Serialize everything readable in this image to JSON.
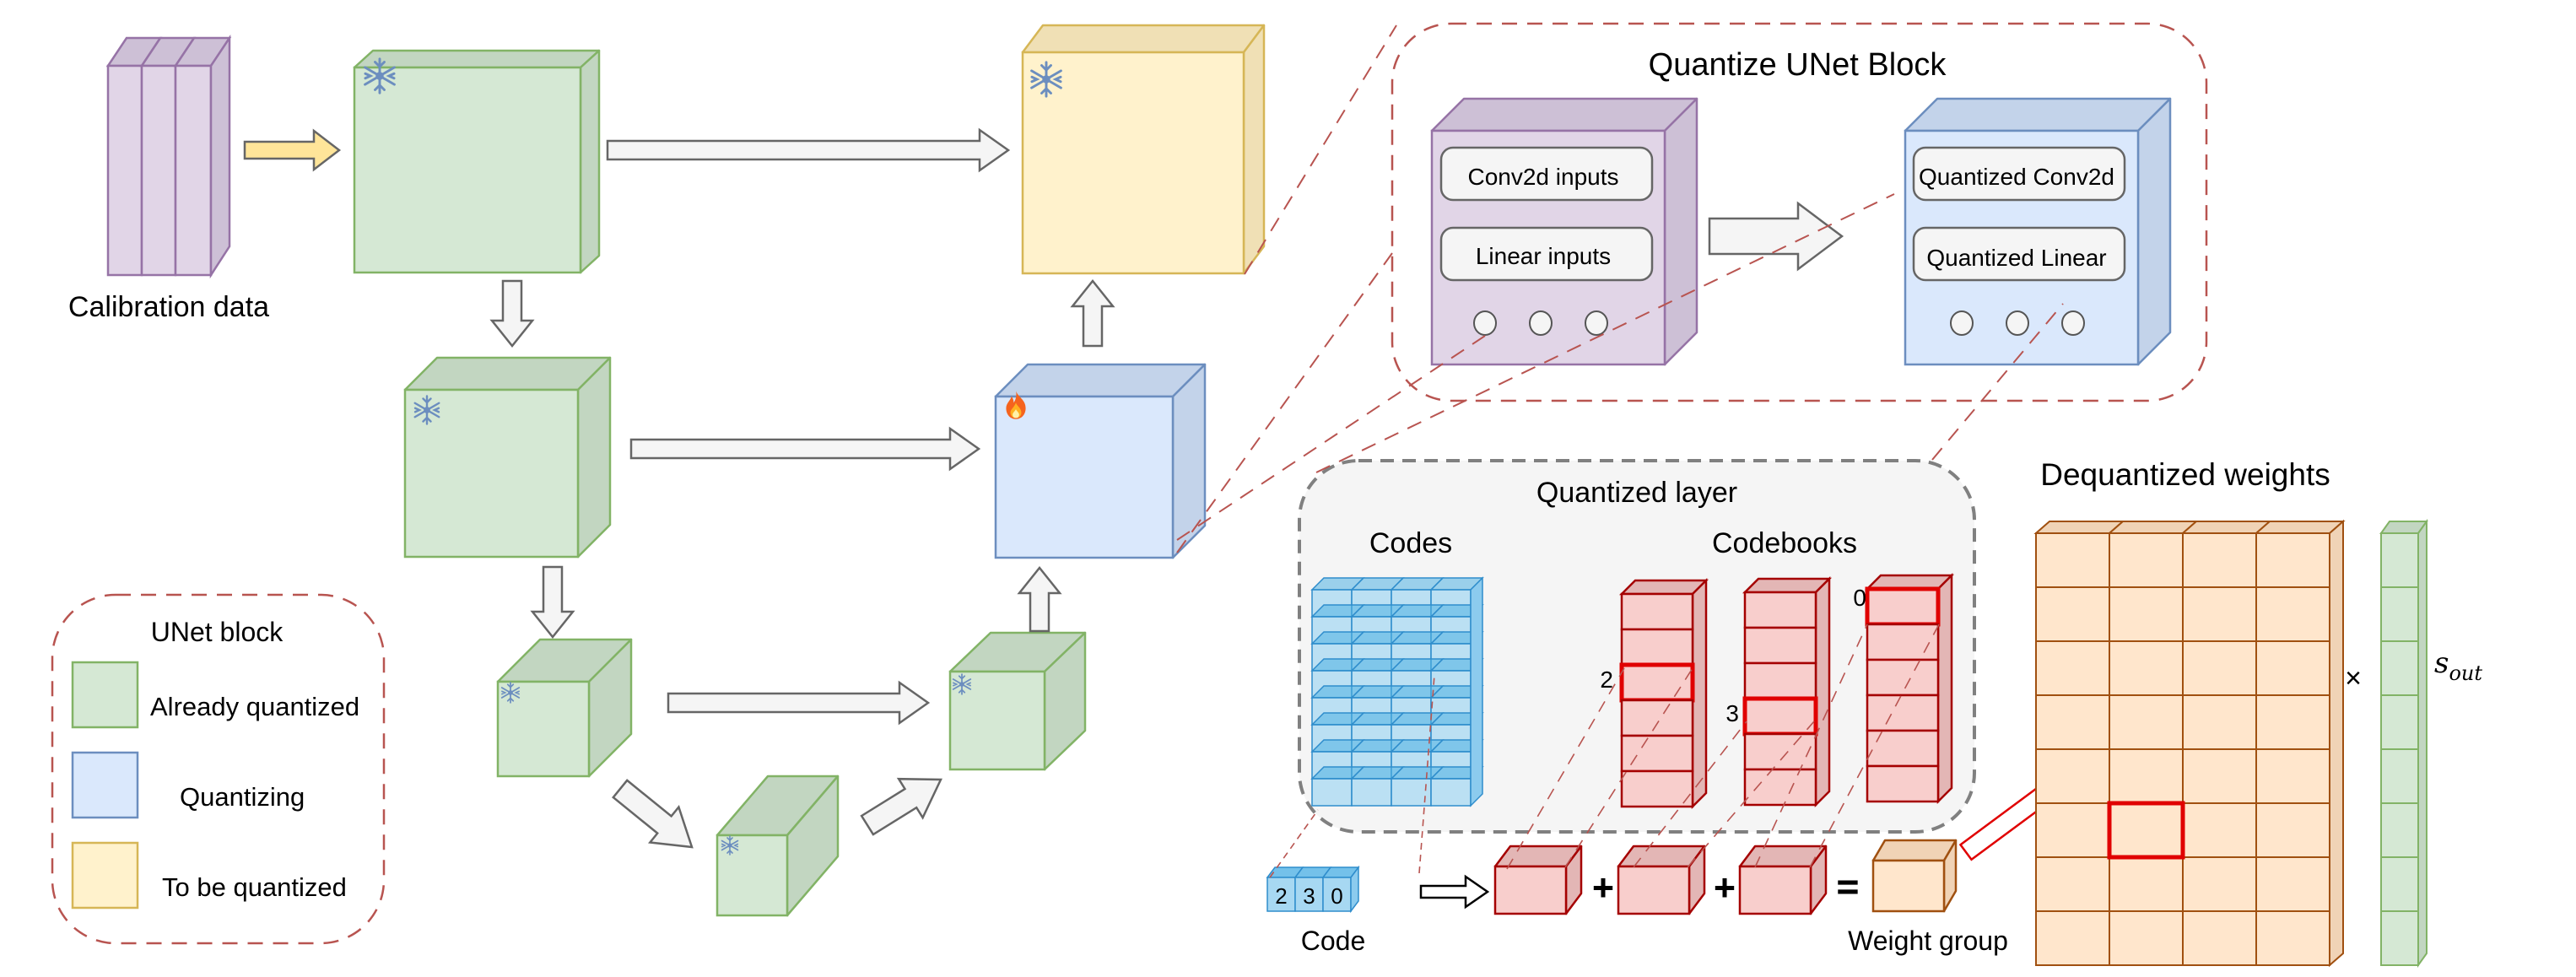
{
  "colors": {
    "green_fill": "#d5e8d4",
    "green_side": "#c2d6c1",
    "green_stroke": "#82b366",
    "blue_fill": "#dae8fc",
    "blue_side": "#c3d3ea",
    "blue_stroke": "#6c8ebf",
    "yellow_fill": "#fff2cc",
    "yellow_side": "#f0e0b5",
    "yellow_stroke": "#d6b656",
    "purple_fill": "#e1d5e7",
    "purple_side": "#cdc0d6",
    "purple_stroke": "#9673a6",
    "red_fill": "#f8cecc",
    "red_side": "#e3b6b5",
    "red_stroke": "#a50000",
    "highlight_red": "#e00000",
    "orange_fill": "#ffe6cc",
    "orange_side": "#f0d3b6",
    "orange_stroke": "#a05010",
    "code_fill": "#a7d8f2",
    "code_stroke": "#2f8dcc",
    "dashed_red": "#b85450",
    "arrow_fill": "#f5f5f5",
    "arrow_stroke": "#666666",
    "calib_arrow_fill": "#ffe599"
  },
  "calibration": {
    "label": "Calibration data"
  },
  "unet": {
    "blocks": [
      {
        "id": "enc1",
        "state": "already_quantized",
        "icon": "snowflake-icon"
      },
      {
        "id": "enc2",
        "state": "already_quantized",
        "icon": "snowflake-icon"
      },
      {
        "id": "enc3",
        "state": "already_quantized",
        "icon": "snowflake-icon"
      },
      {
        "id": "mid",
        "state": "already_quantized",
        "icon": "snowflake-icon"
      },
      {
        "id": "dec3",
        "state": "already_quantized",
        "icon": "snowflake-icon"
      },
      {
        "id": "dec2",
        "state": "quantizing",
        "icon": "fire-icon"
      },
      {
        "id": "dec1",
        "state": "to_be_quantized",
        "icon": "snowflake-icon"
      }
    ]
  },
  "legend": {
    "title": "UNet block",
    "items": [
      {
        "label": "Already quantized",
        "state": "already_quantized"
      },
      {
        "label": "Quantizing",
        "state": "quantizing"
      },
      {
        "label": "To be quantized",
        "state": "to_be_quantized"
      }
    ]
  },
  "quantize_block": {
    "title": "Quantize UNet Block",
    "input_items": [
      "Conv2d inputs",
      "Linear inputs"
    ],
    "output_items": [
      "Quantized Conv2d",
      "Quantized Linear"
    ],
    "ellipsis_dots": 3
  },
  "quantized_layer": {
    "title": "Quantized layer",
    "codes_label": "Codes",
    "codebooks_label": "Codebooks",
    "codes_grid": {
      "rows": 8,
      "cols": 4
    },
    "codebooks": [
      {
        "entries": 6,
        "selected_index": 2,
        "selected_label": "2"
      },
      {
        "entries": 6,
        "selected_index": 3,
        "selected_label": "3"
      },
      {
        "entries": 6,
        "selected_index": 0,
        "selected_label": "0"
      }
    ]
  },
  "code": {
    "label": "Code",
    "values": [
      "2",
      "3",
      "0"
    ]
  },
  "sum": {
    "plus": "+",
    "equals": "=",
    "result_label": "Weight group"
  },
  "dequantized": {
    "title": "Dequantized weights",
    "grid": {
      "rows": 8,
      "cols": 4
    },
    "highlight": {
      "row": 5,
      "col": 1
    },
    "times": "×",
    "scale_label": "s",
    "scale_subscript": "out",
    "scale_entries": 8
  }
}
